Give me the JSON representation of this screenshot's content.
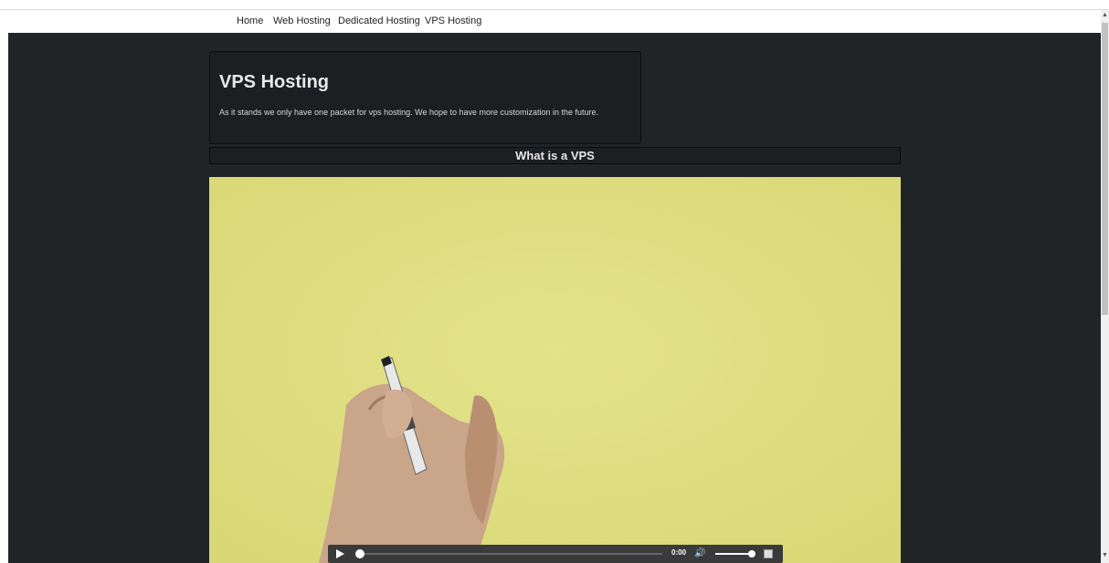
{
  "nav": {
    "items": [
      {
        "label": "Home"
      },
      {
        "label": "Web Hosting"
      },
      {
        "label": "Dedicated Hosting"
      },
      {
        "label": "VPS Hosting"
      }
    ]
  },
  "intro": {
    "title": "VPS Hosting",
    "description": "As it stands we only have one packet for vps hosting. We hope to have more customization in the future."
  },
  "section": {
    "title": "What is a VPS"
  },
  "video": {
    "current_time": "0:00",
    "progress": 0.0,
    "volume": 1.0,
    "icons": {
      "play": "play-icon",
      "volume": "volume-icon",
      "fullscreen": "fullscreen-icon"
    }
  },
  "colors": {
    "page_bg": "#202427",
    "panel_bg": "#1c1f22",
    "video_bg": "#dede7a"
  }
}
